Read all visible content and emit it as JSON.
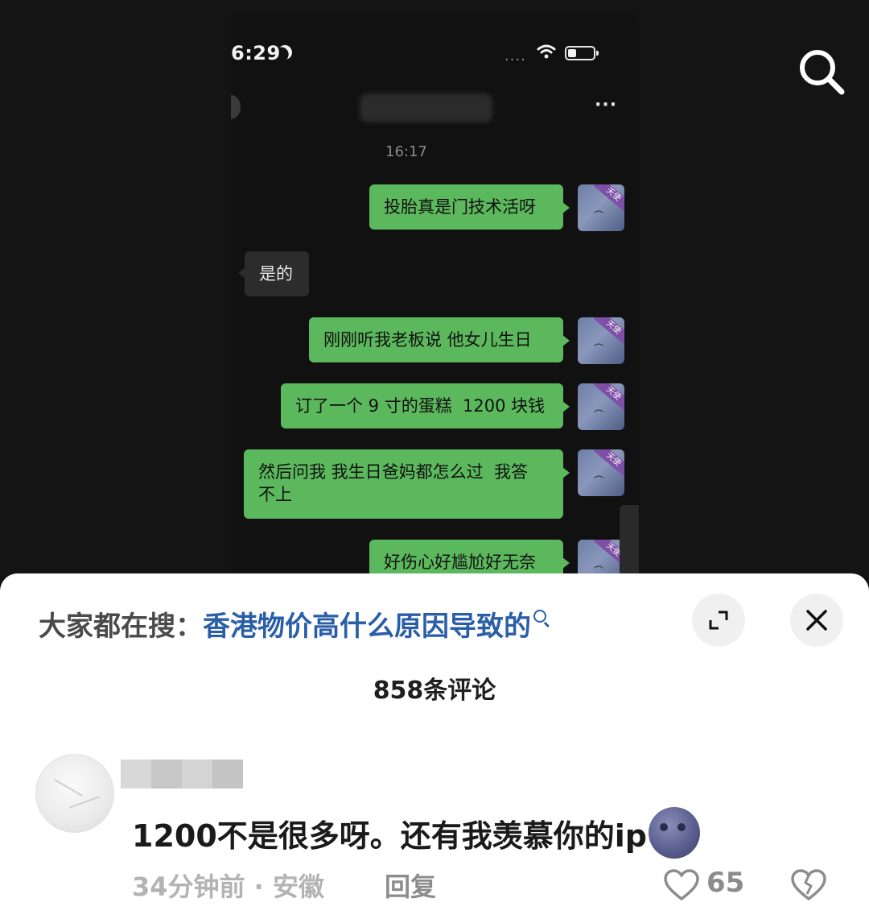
{
  "screenshot": {
    "status_time": "6:29",
    "chat_time": "16:17",
    "avatar_tag": "天使",
    "messages": [
      {
        "side": "right",
        "text": "投胎真是门技术活呀"
      },
      {
        "side": "left",
        "text": "是的"
      },
      {
        "side": "right",
        "text": "刚刚听我老板说 他女儿生日"
      },
      {
        "side": "right",
        "text": "订了一个 9 寸的蛋糕  1200 块钱"
      },
      {
        "side": "right",
        "text": "然后问我 我生日爸妈都怎么过  我答\n不上"
      },
      {
        "side": "right",
        "text": "好伤心好尴尬好无奈"
      }
    ],
    "bubble_color": "#5cb85c"
  },
  "comments_sheet": {
    "hot_search_prefix": "大家都在搜：",
    "hot_search_query": "香港物价高什么原因导致的",
    "comment_count": "858条评论",
    "comment": {
      "text": "1200不是很多呀。还有我羡慕你的ip",
      "emoji": "new-moon-face",
      "time_location": "34分钟前 · 安徽",
      "reply_label": "回复",
      "like_count": "65"
    },
    "link_color": "#2a5fa8"
  },
  "icons": {
    "top_right": "search-icon",
    "expand": "expand-icon",
    "close": "close-icon",
    "like": "heart-icon",
    "dislike": "broken-heart-icon"
  }
}
